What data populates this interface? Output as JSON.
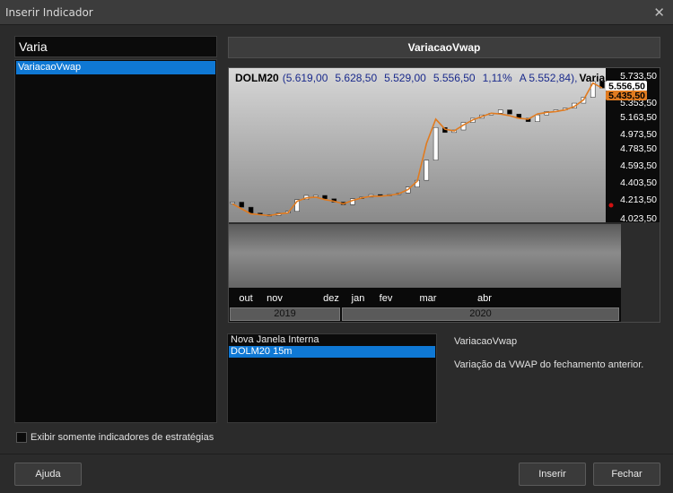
{
  "window": {
    "title": "Inserir Indicador"
  },
  "search": {
    "value": "Varia"
  },
  "indicator_list": {
    "items": [
      "VariacaoVwap"
    ]
  },
  "filter": {
    "label": "Exibir somente indicadores de estratégias",
    "checked": false
  },
  "buttons": {
    "help": "Ajuda",
    "insert": "Inserir",
    "close": "Fechar"
  },
  "preview": {
    "title": "VariacaoVwap",
    "quote": {
      "symbol": "DOLM20",
      "open": "5.619,00",
      "high": "5.628,50",
      "low": "5.529,00",
      "close": "5.556,50",
      "change": "1,11%",
      "avg": "A 5.552,84",
      "indicator": "Varia"
    },
    "price_tags": {
      "last": "5.556,50",
      "vwap": "5.435,50"
    }
  },
  "targets": {
    "items": [
      "Nova Janela Interna",
      "DOLM20 15m"
    ],
    "selected": 1
  },
  "description": {
    "name": "VariacaoVwap",
    "text": "Variação da VWAP do fechamento anterior."
  },
  "colors": {
    "accent": "#0f78d4",
    "quote_blue": "#1a2a8c",
    "vwap_line": "#e07b20",
    "candle_up": "#ffffff",
    "candle_down": "#000000"
  },
  "chart_data": {
    "type": "line",
    "ylim": [
      4023.5,
      5733.5
    ],
    "y_ticks": [
      "5.733,50",
      "5.353,50",
      "5.163,50",
      "4.973,50",
      "4.783,50",
      "4.593,50",
      "4.403,50",
      "4.213,50",
      "4.023,50"
    ],
    "x_month_labels": [
      "out",
      "nov",
      "dez",
      "jan",
      "fev",
      "mar",
      "abr"
    ],
    "year_labels": [
      "2019",
      "2020"
    ],
    "series": [
      {
        "role": "vwap",
        "values": [
          4180,
          4120,
          4060,
          4050,
          4040,
          4060,
          4070,
          4210,
          4250,
          4260,
          4230,
          4210,
          4180,
          4220,
          4250,
          4270,
          4270,
          4280,
          4300,
          4350,
          4450,
          4900,
          5190,
          5070,
          5050,
          5120,
          5180,
          5220,
          5260,
          5250,
          5230,
          5200,
          5190,
          5250,
          5270,
          5280,
          5300,
          5340,
          5420,
          5620,
          5560
        ]
      },
      {
        "role": "price",
        "values": [
          4200,
          4140,
          4070,
          4050,
          4040,
          4070,
          4090,
          4230,
          4280,
          4280,
          4240,
          4200,
          4170,
          4240,
          4260,
          4290,
          4280,
          4290,
          4310,
          4380,
          4460,
          4700,
          5090,
          5030,
          5060,
          5150,
          5200,
          5240,
          5260,
          5300,
          5250,
          5200,
          5160,
          5240,
          5280,
          5300,
          5320,
          5380,
          5450,
          5640,
          5560
        ]
      }
    ]
  }
}
